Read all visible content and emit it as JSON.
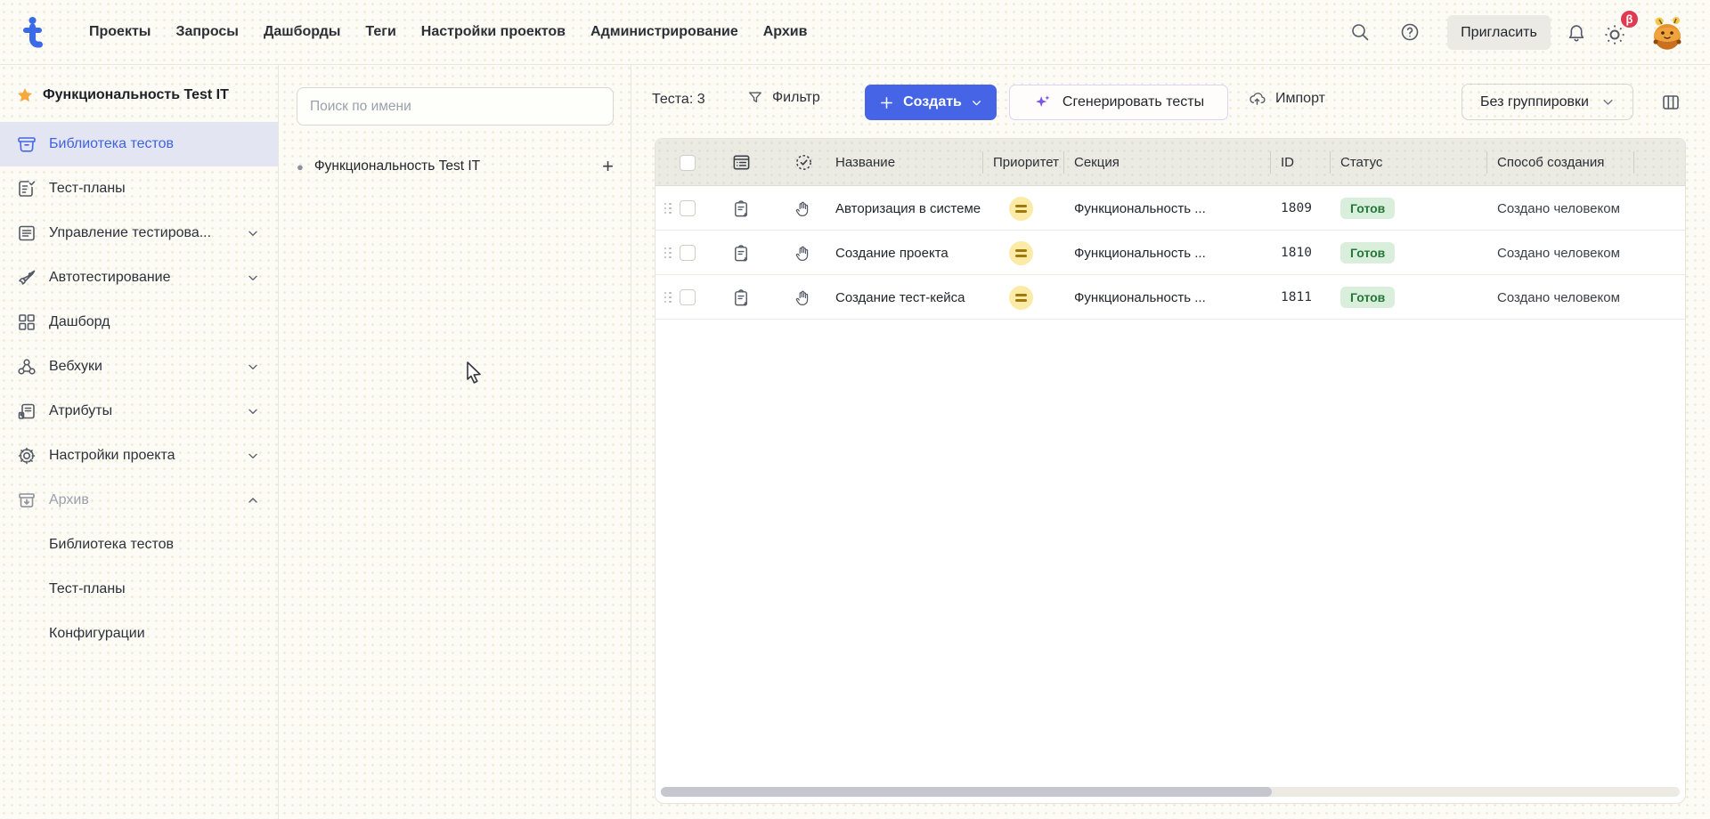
{
  "topbar": {
    "logo_letter": "t",
    "nav": [
      {
        "label": "Проекты"
      },
      {
        "label": "Запросы"
      },
      {
        "label": "Дашборды"
      },
      {
        "label": "Теги"
      },
      {
        "label": "Настройки проектов"
      },
      {
        "label": "Администрирование"
      },
      {
        "label": "Архив"
      }
    ],
    "invite_label": "Пригласить",
    "beta_badge": "β"
  },
  "sidebar": {
    "project_name": "Функциональность Test IT",
    "items": [
      {
        "label": "Библиотека тестов",
        "icon": "library-icon",
        "selected": true
      },
      {
        "label": "Тест-планы",
        "icon": "test-plans-icon"
      },
      {
        "label": "Управление тестирова...",
        "icon": "test-management-icon",
        "chevron": "down"
      },
      {
        "label": "Автотестирование",
        "icon": "rocket-icon",
        "chevron": "down"
      },
      {
        "label": "Дашборд",
        "icon": "dashboard-icon"
      },
      {
        "label": "Вебхуки",
        "icon": "webhook-icon",
        "chevron": "down"
      },
      {
        "label": "Атрибуты",
        "icon": "attributes-icon",
        "chevron": "down"
      },
      {
        "label": "Настройки проекта",
        "icon": "gear-icon",
        "chevron": "down"
      },
      {
        "label": "Архив",
        "icon": "archive-icon",
        "chevron": "up",
        "muted": true
      }
    ],
    "archive_subitems": [
      {
        "label": "Библиотека тестов"
      },
      {
        "label": "Тест-планы"
      },
      {
        "label": "Конфигурации"
      }
    ]
  },
  "tree_panel": {
    "search_placeholder": "Поиск по имени",
    "root_node_label": "Функциональность Test IT",
    "add_label": "+"
  },
  "toolbar": {
    "count_label": "Теста: 3",
    "filter_label": "Фильтр",
    "create_label": "Создать",
    "generate_label": "Сгенерировать тесты",
    "import_label": "Импорт",
    "grouping_label": "Без группировки"
  },
  "table": {
    "columns": {
      "name": "Название",
      "priority": "Приоритет",
      "section": "Секция",
      "id": "ID",
      "status": "Статус",
      "creation": "Способ создания"
    },
    "rows": [
      {
        "name": "Авторизация в системе",
        "priority": "medium",
        "section": "Функциональность ...",
        "id": "1809",
        "status": "Готов",
        "creation": "Создано человеком"
      },
      {
        "name": "Создание проекта",
        "priority": "medium",
        "section": "Функциональность ...",
        "id": "1810",
        "status": "Готов",
        "creation": "Создано человеком"
      },
      {
        "name": "Создание тест-кейса",
        "priority": "medium",
        "section": "Функциональность ...",
        "id": "1811",
        "status": "Готов",
        "creation": "Создано человеком"
      }
    ]
  },
  "colors": {
    "accent_blue": "#4565e6",
    "selected_bg": "#e3e6f2",
    "selected_text": "#3f62df",
    "status_ready_bg": "#d9efdc",
    "status_ready_text": "#25763a",
    "priority_medium_bg": "#fbeba6",
    "priority_medium_bar": "#9d7a0b",
    "beta_red": "#e03a50",
    "star_orange": "#f5a83c"
  }
}
